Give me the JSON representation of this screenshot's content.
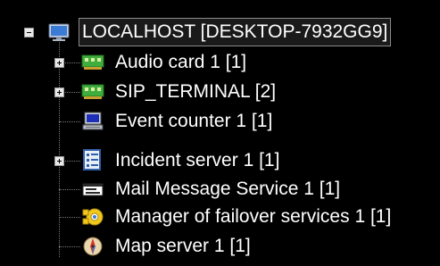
{
  "tree": {
    "root": {
      "label": "LOCALHOST [DESKTOP-7932GG9]",
      "icon": "monitor-icon",
      "expanded": true,
      "selected": true
    },
    "children": [
      {
        "label": "Audio card 1 [1]",
        "icon": "audio-card-icon",
        "expandable": true,
        "expanded": false
      },
      {
        "label": "SIP_TERMINAL [2]",
        "icon": "sip-board-icon",
        "expandable": true,
        "expanded": false
      },
      {
        "label": "Event counter 1 [1]",
        "icon": "computer-icon",
        "expandable": false
      },
      {
        "label": "Incident server 1 [1]",
        "icon": "incident-server-icon",
        "expandable": true,
        "expanded": false
      },
      {
        "label": "Mail Message Service 1 [1]",
        "icon": "mail-service-icon",
        "expandable": false
      },
      {
        "label": "Manager of failover services 1 [1]",
        "icon": "failover-manager-icon",
        "expandable": false
      },
      {
        "label": "Map server 1 [1]",
        "icon": "map-server-icon",
        "expandable": false
      }
    ]
  },
  "colors": {
    "background": "#000000",
    "text": "#ffffff",
    "connector": "#7a7a7a",
    "board_green": "#3fae3f",
    "monitor_blue": "#3a7bd5"
  }
}
